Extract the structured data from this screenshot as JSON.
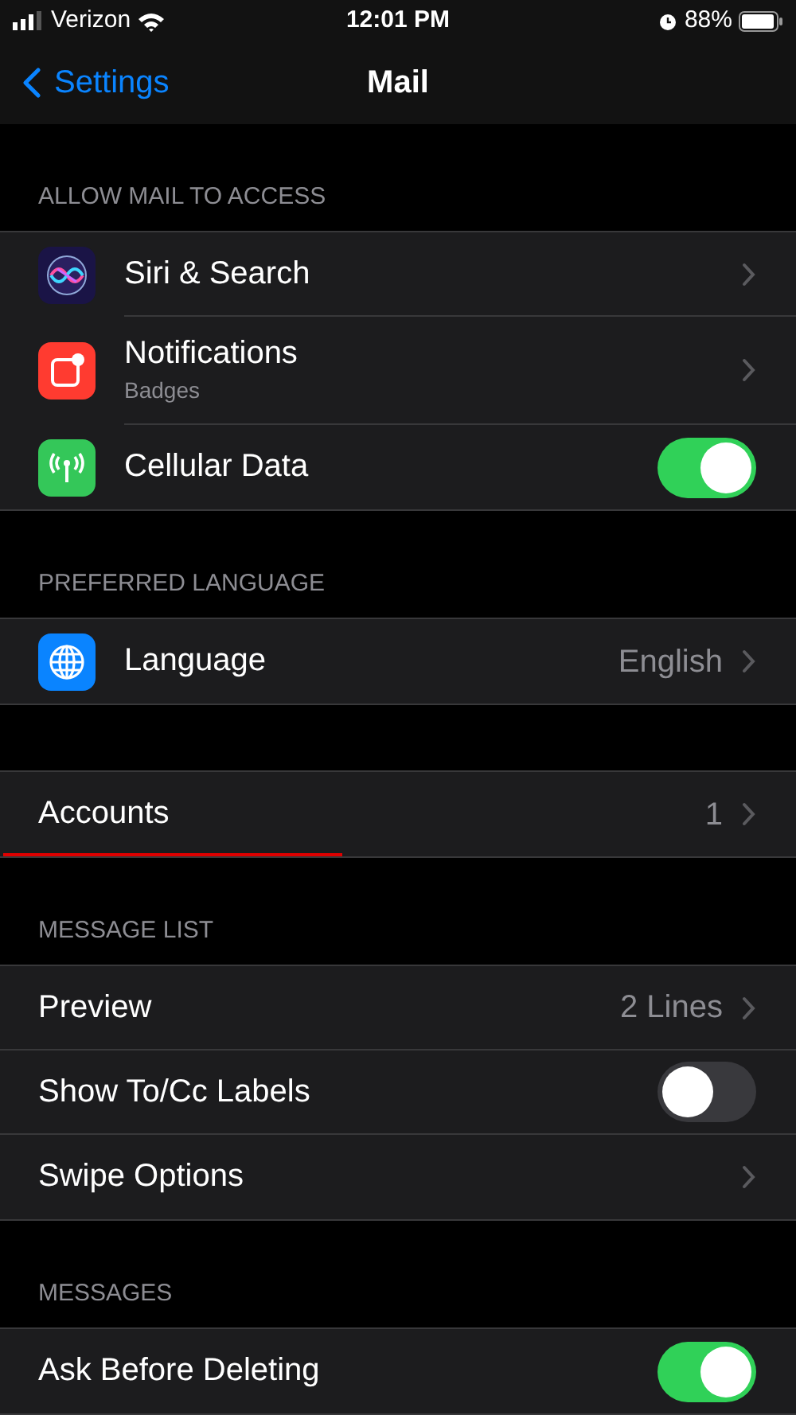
{
  "status_bar": {
    "carrier": "Verizon",
    "time": "12:01 PM",
    "battery": "88%"
  },
  "nav": {
    "back": "Settings",
    "title": "Mail"
  },
  "sections": [
    {
      "header": "ALLOW MAIL TO ACCESS",
      "rows": [
        {
          "kind": "chevron",
          "label": "Siri & Search"
        },
        {
          "kind": "chevron",
          "label": "Notifications",
          "subtitle": "Badges"
        },
        {
          "kind": "toggle",
          "label": "Cellular Data",
          "on": true
        }
      ]
    },
    {
      "header": "PREFERRED LANGUAGE",
      "rows": [
        {
          "kind": "chevron",
          "label": "Language",
          "value": "English"
        }
      ]
    },
    {
      "rows": [
        {
          "kind": "chevron",
          "label": "Accounts",
          "value": "1",
          "marked": true
        }
      ]
    },
    {
      "header": "MESSAGE LIST",
      "rows": [
        {
          "kind": "chevron",
          "label": "Preview",
          "value": "2 Lines"
        },
        {
          "kind": "toggle",
          "label": "Show To/Cc Labels",
          "on": false
        },
        {
          "kind": "chevron",
          "label": "Swipe Options"
        }
      ]
    },
    {
      "header": "MESSAGES",
      "rows": [
        {
          "kind": "toggle",
          "label": "Ask Before Deleting",
          "on": true
        }
      ]
    }
  ]
}
